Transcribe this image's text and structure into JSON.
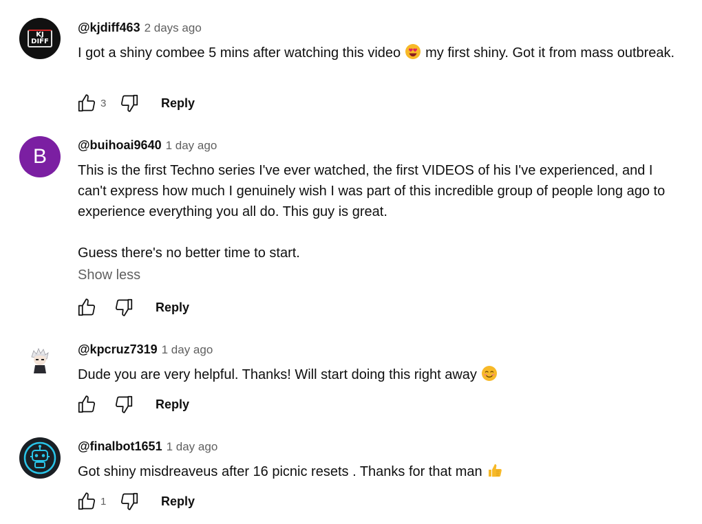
{
  "comments": [
    {
      "author": "@kjdiff463",
      "timestamp": "2 days ago",
      "avatar_text": [
        "KJ",
        "DIFF"
      ],
      "text_before_emoji": "I got a shiny combee 5 mins after watching this video",
      "emoji": "heart-eyes-emoji",
      "text_after_emoji": "my first shiny. Got it from mass outbreak.",
      "likes": "3",
      "reply_label": "Reply"
    },
    {
      "author": "@buihoai9640",
      "timestamp": "1 day ago",
      "avatar_letter": "B",
      "paragraph_1": "This is the first Techno series I've ever watched, the first VIDEOS of his I've experienced, and I can't express how much I genuinely wish I was part of this incredible group of people long ago to experience everything you all do. This guy is great.",
      "paragraph_2": "Guess there's no better time to start.",
      "show_less_label": "Show less",
      "likes": "",
      "reply_label": "Reply"
    },
    {
      "author": "@kpcruz7319",
      "timestamp": "1 day ago",
      "text_before_emoji": "Dude you are very helpful. Thanks! Will start doing this right away",
      "emoji": "smiling-blush-emoji",
      "likes": "",
      "reply_label": "Reply"
    },
    {
      "author": "@finalbot1651",
      "timestamp": "1 day ago",
      "text_before_emoji": "Got shiny misdreaveus after 16 picnic resets . Thanks for that man",
      "emoji": "thumbs-up-emoji",
      "likes": "1",
      "reply_label": "Reply"
    }
  ],
  "colors": {
    "avatar_b": "#7b1fa2",
    "meta_gray": "#606060",
    "text": "#0f0f0f"
  }
}
